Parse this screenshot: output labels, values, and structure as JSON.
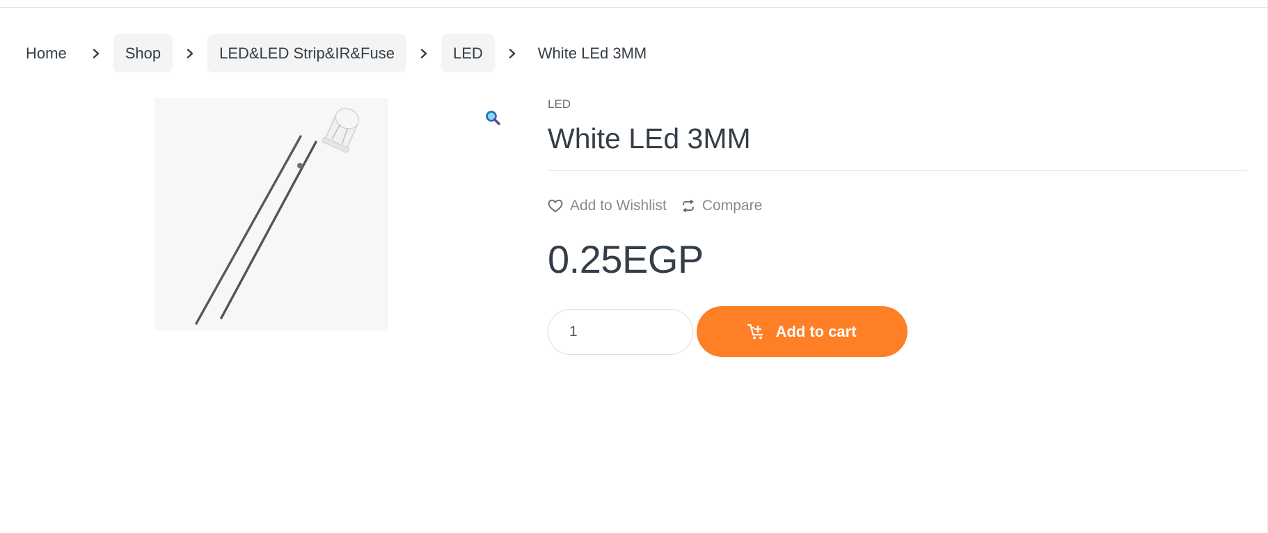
{
  "breadcrumb": {
    "items": [
      {
        "label": "Home"
      },
      {
        "label": "Shop"
      },
      {
        "label": "LED&LED Strip&IR&Fuse"
      },
      {
        "label": "LED"
      }
    ],
    "current": "White LEd 3MM",
    "separator_icon": "chevron-right-icon"
  },
  "gallery": {
    "zoom_icon": "magnifier-icon"
  },
  "product": {
    "category": "LED",
    "title": "White LEd 3MM",
    "wishlist_label": "Add to Wishlist",
    "wishlist_icon": "heart-icon",
    "compare_label": "Compare",
    "compare_icon": "sync-arrows-icon",
    "price": "0.25EGP",
    "quantity": "1",
    "add_to_cart_label": "Add to cart",
    "add_to_cart_icon": "cart-plus-icon",
    "accent_color": "#fe7f26"
  }
}
